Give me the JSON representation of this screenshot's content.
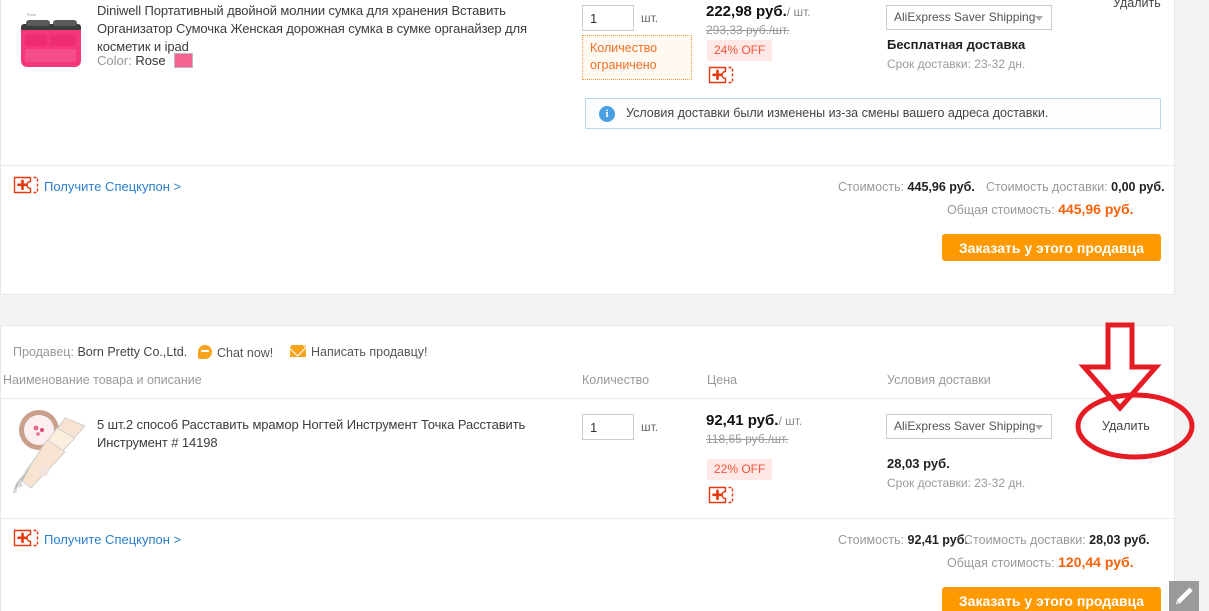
{
  "page": {
    "accent_orange": "#f90",
    "accent_price": "#f7620a",
    "link_blue": "#2b7fd0",
    "annotation_red": "#e51c23"
  },
  "sellers": [
    {
      "id": "seller-1",
      "product": {
        "title": "Diniwell Портативный двойной молнии сумка для хранения Вставить Организатор Сумочка Женская дорожная сумка в сумке органайзер для косметик и ipad",
        "attr_label": "Color:",
        "attr_value": "Rose",
        "swatch_color": "#f56491",
        "thumb_alt": "pink-cosmetic-bag-organizer"
      },
      "quantity": {
        "value": "1",
        "unit": "шт.",
        "limit_notice": "Количество ограничено"
      },
      "price": {
        "current": "222,98 руб.",
        "per_unit": "/ шт.",
        "original": "293,33 руб./шт.",
        "discount_badge": "24% OFF",
        "coupon_icon": "coupon-ticket-icon"
      },
      "shipping": {
        "method": "AliExpress Saver Shipping",
        "cost_label": "Бесплатная доставка",
        "delivery_time": "Срок доставки: 23-32 дн."
      },
      "remove_label": "Удалить",
      "notice": {
        "icon": "info-icon",
        "text": "Условия доставки были изменены из-за смены вашего адреса доставки."
      },
      "coupon_link": "Получите Спецкупон >",
      "totals": {
        "subtotal_label": "Стоимость:",
        "subtotal_value": "445,96 руб.",
        "shipping_label": "Стоимость доставки:",
        "shipping_value": "0,00 руб.",
        "grand_label": "Общая стоимость:",
        "grand_value": "445,96 руб."
      },
      "order_button": "Заказать у этого продавца"
    },
    {
      "id": "seller-2",
      "header": {
        "seller_label": "Продавец:",
        "seller_name": "Born Pretty Co.,Ltd.",
        "chat_label": "Chat now!",
        "message_label": "Написать продавцу!"
      },
      "columns": {
        "name": "Наименование товара и описание",
        "quantity": "Количество",
        "price": "Цена",
        "shipping": "Условия доставки"
      },
      "product": {
        "title": "5 шт.2 способ Расставить мрамор Ногтей Инструмент Точка Расставить Инструмент # 14198",
        "thumb_alt": "nail-dotting-tools"
      },
      "quantity": {
        "value": "1",
        "unit": "шт."
      },
      "price": {
        "current": "92,41 руб.",
        "per_unit": "/ шт.",
        "original": "118,65 руб./шт.",
        "discount_badge": "22% OFF",
        "coupon_icon": "coupon-ticket-icon"
      },
      "shipping": {
        "method": "AliExpress Saver Shipping",
        "cost_label": "28,03 руб.",
        "delivery_time": "Срок доставки: 23-32 дн."
      },
      "remove_label": "Удалить",
      "coupon_link": "Получите Спецкупон >",
      "totals": {
        "subtotal_label": "Стоимость:",
        "subtotal_value": "92,41 руб.",
        "shipping_label": "Стоимость доставки:",
        "shipping_value": "28,03 руб.",
        "grand_label": "Общая стоимость:",
        "grand_value": "120,44 руб."
      },
      "order_button": "Заказать у этого продавца"
    }
  ],
  "annotations": {
    "arrow": "down-arrow-annotation",
    "ellipse": "ellipse-annotation-around-remove"
  },
  "fab": {
    "icon": "pencil-edit-icon"
  }
}
